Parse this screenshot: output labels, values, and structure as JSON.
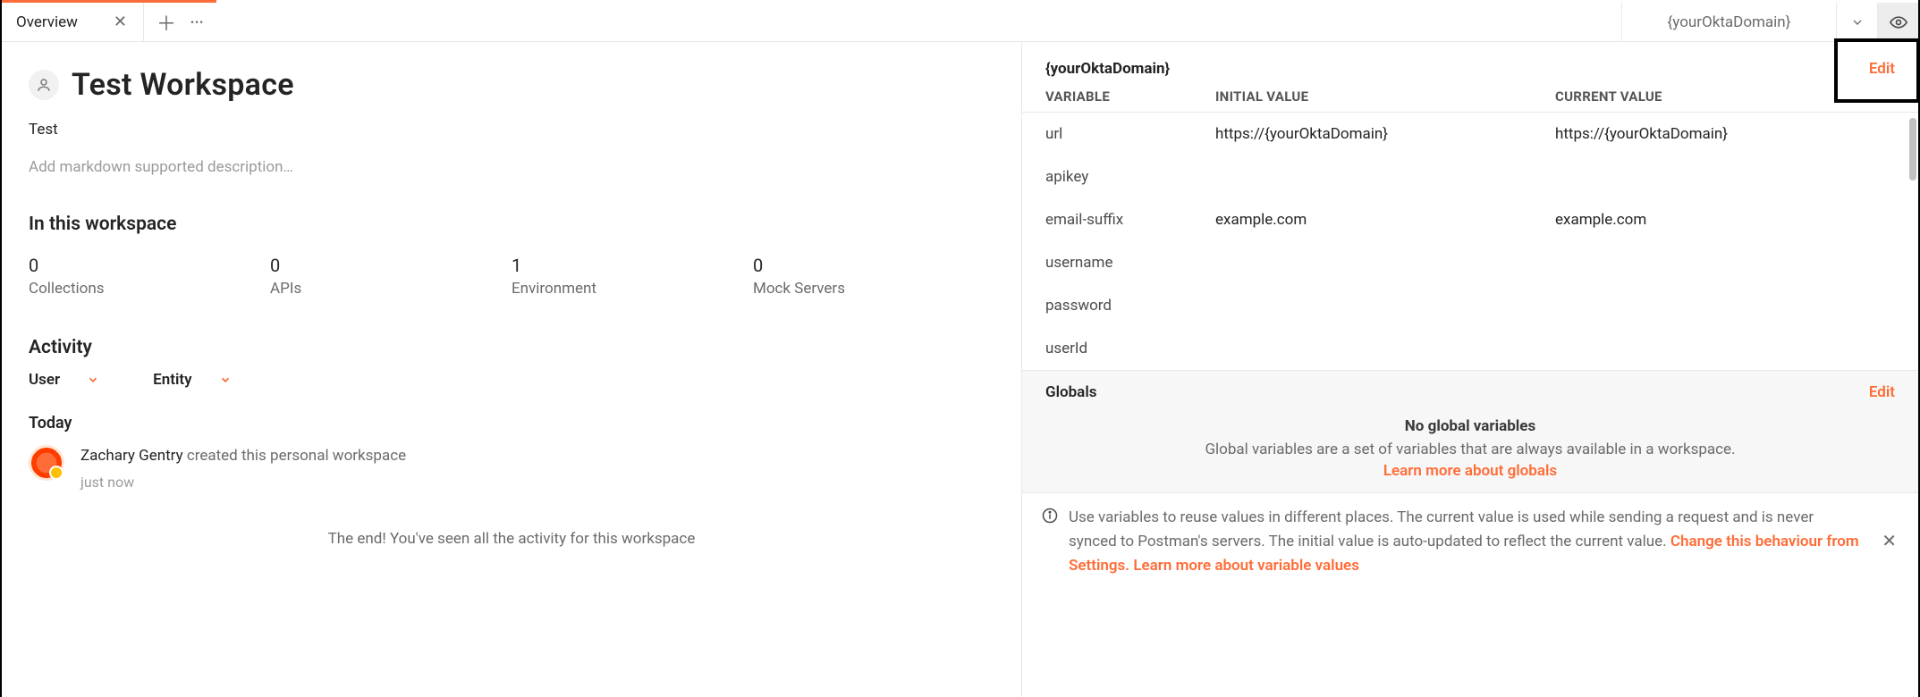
{
  "tabs": {
    "overview": "Overview"
  },
  "env": {
    "name": "{yourOktaDomain}"
  },
  "workspace": {
    "title": "Test Workspace",
    "subtitle": "Test",
    "description_placeholder": "Add markdown supported description…",
    "section_heading": "In this workspace",
    "stats": [
      {
        "value": "0",
        "label": "Collections"
      },
      {
        "value": "0",
        "label": "APIs"
      },
      {
        "value": "1",
        "label": "Environment"
      },
      {
        "value": "0",
        "label": "Mock Servers"
      }
    ]
  },
  "activity": {
    "heading": "Activity",
    "filters": {
      "user": "User",
      "entity": "Entity"
    },
    "group": "Today",
    "item": {
      "actor": "Zachary Gentry",
      "rest": " created this personal workspace",
      "time": "just now"
    },
    "end": "The end! You've seen all the activity for this workspace"
  },
  "panel": {
    "header": "{yourOktaDomain}",
    "edit": "Edit",
    "columns": {
      "var": "VARIABLE",
      "init": "INITIAL VALUE",
      "cur": "CURRENT VALUE"
    },
    "rows": [
      {
        "var": "url",
        "init": "https://{yourOktaDomain}",
        "cur": "https://{yourOktaDomain}"
      },
      {
        "var": "apikey",
        "init": "",
        "cur": ""
      },
      {
        "var": "email-suffix",
        "init": "example.com",
        "cur": "example.com"
      },
      {
        "var": "username",
        "init": "",
        "cur": ""
      },
      {
        "var": "password",
        "init": "",
        "cur": ""
      },
      {
        "var": "userId",
        "init": "",
        "cur": ""
      }
    ]
  },
  "globals": {
    "header": "Globals",
    "edit": "Edit",
    "empty_title": "No global variables",
    "empty_text": "Global variables are a set of variables that are always available in a workspace.",
    "link": "Learn more about globals"
  },
  "footer": {
    "text_a": "Use variables to reuse values in different places. The current value is used while sending a request and is never synced to Postman's servers. The initial value is auto-updated to reflect the current value. ",
    "link_a": "Change this behaviour from Settings.",
    "link_b": "Learn more about variable values"
  }
}
